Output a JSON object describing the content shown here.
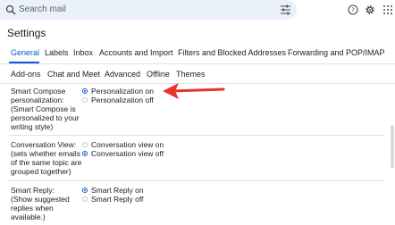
{
  "search": {
    "placeholder": "Search mail"
  },
  "page": {
    "title": "Settings"
  },
  "tabs_row1": [
    "General",
    "Labels",
    "Inbox",
    "Accounts and Import",
    "Filters and Blocked Addresses",
    "Forwarding and POP/IMAP"
  ],
  "tabs_row2": [
    "Add-ons",
    "Chat and Meet",
    "Advanced",
    "Offline",
    "Themes"
  ],
  "settings": [
    {
      "label": "Smart Compose personalization:",
      "description": "(Smart Compose is personalized to your writing style)",
      "options": [
        "Personalization on",
        "Personalization off"
      ],
      "selected": 0
    },
    {
      "label": "Conversation View:",
      "description": "(sets whether emails of the same topic are grouped together)",
      "options": [
        "Conversation view on",
        "Conversation view off"
      ],
      "selected": 1
    },
    {
      "label": "Smart Reply:",
      "description": "(Show suggested replies when available.)",
      "options": [
        "Smart Reply on",
        "Smart Reply off"
      ],
      "selected": 0
    }
  ],
  "colors": {
    "accent": "#0b57d0",
    "annotation_arrow": "#e8322c",
    "search_bg": "#eaf1fb"
  }
}
